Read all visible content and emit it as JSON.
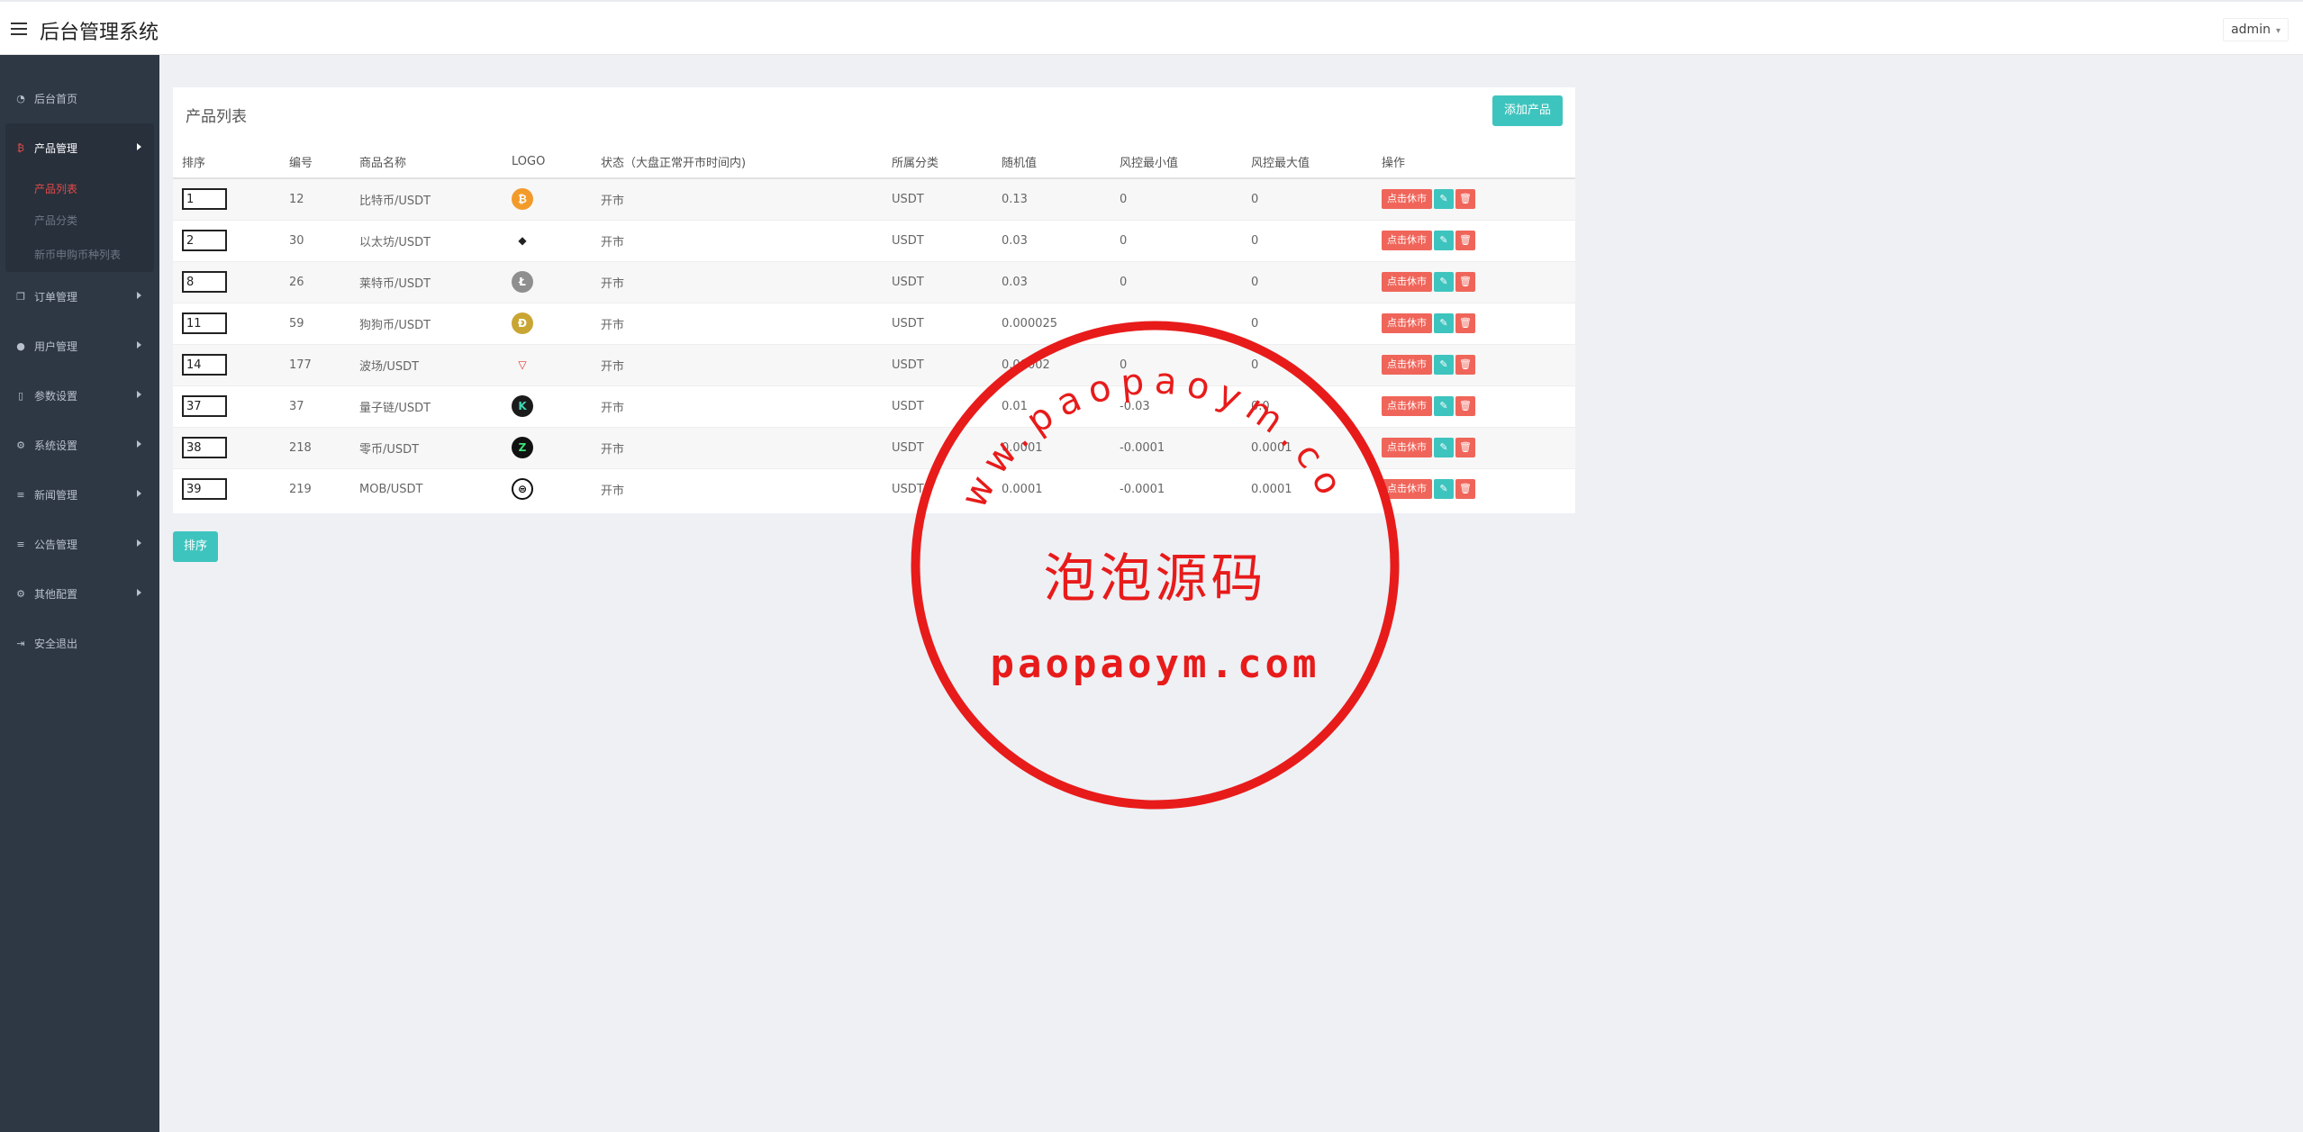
{
  "header": {
    "title": "后台管理系统",
    "user": "admin"
  },
  "sidebar": {
    "items": [
      {
        "label": "后台首页",
        "icon": "dashboard-icon"
      },
      {
        "label": "产品管理",
        "icon": "bitcoin-icon",
        "open": true,
        "children": [
          {
            "label": "产品列表",
            "active": true
          },
          {
            "label": "产品分类"
          },
          {
            "label": "新币申购币种列表"
          }
        ]
      },
      {
        "label": "订单管理",
        "icon": "copy-icon"
      },
      {
        "label": "用户管理",
        "icon": "user-icon"
      },
      {
        "label": "参数设置",
        "icon": "file-icon"
      },
      {
        "label": "系统设置",
        "icon": "gears-icon"
      },
      {
        "label": "新闻管理",
        "icon": "list-icon"
      },
      {
        "label": "公告管理",
        "icon": "list-icon"
      },
      {
        "label": "其他配置",
        "icon": "gear-icon"
      },
      {
        "label": "安全退出",
        "icon": "logout-icon"
      }
    ]
  },
  "panel": {
    "title": "产品列表",
    "add_button": "添加产品",
    "sort_button": "排序"
  },
  "table": {
    "headers": [
      "排序",
      "编号",
      "商品名称",
      "LOGO",
      "状态（大盘正常开市时间内)",
      "所属分类",
      "随机值",
      "风控最小值",
      "风控最大值",
      "操作"
    ],
    "action_label": "点击休市",
    "rows": [
      {
        "sort": "1",
        "id": "12",
        "name": "比特币/USDT",
        "logo": "btc",
        "status": "开市",
        "category": "USDT",
        "random": "0.13",
        "min": "0",
        "max": "0"
      },
      {
        "sort": "2",
        "id": "30",
        "name": "以太坊/USDT",
        "logo": "eth",
        "status": "开市",
        "category": "USDT",
        "random": "0.03",
        "min": "0",
        "max": "0"
      },
      {
        "sort": "8",
        "id": "26",
        "name": "莱特币/USDT",
        "logo": "ltc",
        "status": "开市",
        "category": "USDT",
        "random": "0.03",
        "min": "0",
        "max": "0"
      },
      {
        "sort": "11",
        "id": "59",
        "name": "狗狗币/USDT",
        "logo": "doge",
        "status": "开市",
        "category": "USDT",
        "random": "0.000025",
        "min": "",
        "max": "0"
      },
      {
        "sort": "14",
        "id": "177",
        "name": "波场/USDT",
        "logo": "trx",
        "status": "开市",
        "category": "USDT",
        "random": "0.00002",
        "min": "0",
        "max": "0"
      },
      {
        "sort": "37",
        "id": "37",
        "name": "量子链/USDT",
        "logo": "kava",
        "status": "开市",
        "category": "USDT",
        "random": "0.01",
        "min": "-0.03",
        "max": "0.0"
      },
      {
        "sort": "38",
        "id": "218",
        "name": "零币/USDT",
        "logo": "zec",
        "status": "开市",
        "category": "USDT",
        "random": "0.0001",
        "min": "-0.0001",
        "max": "0.0001"
      },
      {
        "sort": "39",
        "id": "219",
        "name": "MOB/USDT",
        "logo": "mob",
        "status": "开市",
        "category": "USDT",
        "random": "0.0001",
        "min": "-0.0001",
        "max": "0.0001"
      }
    ]
  },
  "watermark": {
    "ring_text": "www.paopaoym.com",
    "center_text": "泡泡源码",
    "url_text": "paopaoym.com",
    "color": "#e81b1b"
  }
}
